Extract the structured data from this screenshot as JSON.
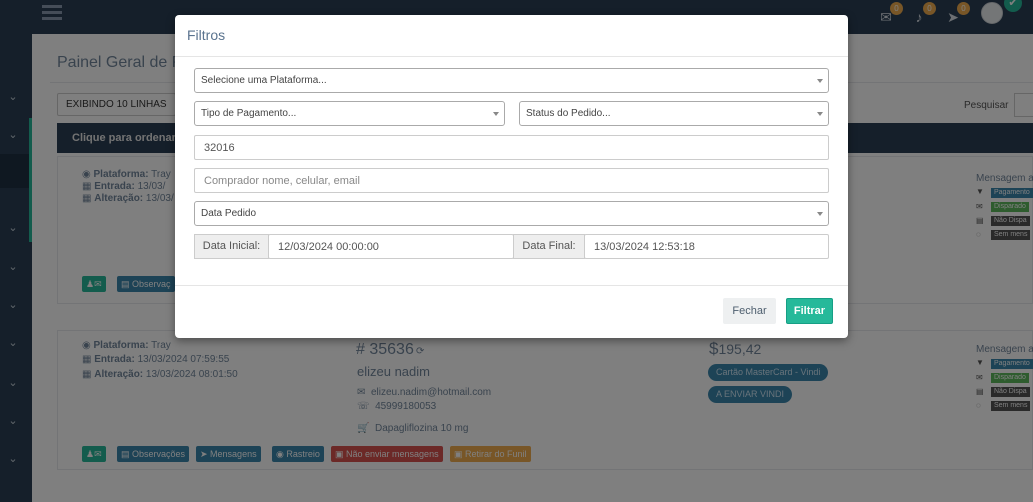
{
  "topbar": {
    "badges": [
      "0",
      "0",
      "0"
    ]
  },
  "page": {
    "title": "Painel Geral de Pe",
    "exibindo_label": "EXIBINDO 10 LINHAS",
    "search_label": "Pesquisar",
    "table_header": "Clique para ordenar ⬍"
  },
  "cards": [
    {
      "plataforma_label": "Plataforma:",
      "plataforma_value": "Tray",
      "entrada_label": "Entrada:",
      "entrada_value": "13/03/",
      "alteracao_label": "Alteração:",
      "alteracao_value": "13/03/",
      "mensagem_title": "Mensagem a",
      "tags": [
        "Pagamento",
        "Disparado",
        "Não Dispa",
        "Sem mens"
      ],
      "actions": [
        "",
        "Observaç"
      ]
    },
    {
      "plataforma_label": "Plataforma:",
      "plataforma_value": "Tray",
      "entrada_label": "Entrada:",
      "entrada_value": "13/03/2024 07:59:55",
      "alteracao_label": "Alteração:",
      "alteracao_value": "13/03/2024 08:01:50",
      "order_number": "# 35636",
      "buyer": "elizeu nadim",
      "email": "elizeu.nadim@hotmail.com",
      "phone": "45999180053",
      "product": "Dapagliflozina 10 mg",
      "currency": "$",
      "price": "195,42",
      "pill_1": "Cartão MasterCard - Vindi",
      "pill_2": "A ENVIAR VINDI",
      "mensagem_title": "Mensagem a",
      "tags": [
        "Pagamento",
        "Disparado",
        "Não Dispa",
        "Sem mens"
      ],
      "actions": [
        "",
        "Observações",
        "Mensagens",
        "Rastreio",
        "Não enviar mensagens",
        "Retirar do Funil"
      ]
    }
  ],
  "modal": {
    "title": "Filtros",
    "plataforma_select": "Selecione uma Plataforma...",
    "pagamento_select": "Tipo de Pagamento...",
    "status_select": "Status do Pedido...",
    "pedido_value": "32016",
    "comprador_placeholder": "Comprador nome, celular, email",
    "data_select": "Data Pedido",
    "data_inicial_label": "Data Inicial:",
    "data_inicial_value": "12/03/2024 00:00:00",
    "data_final_label": "Data Final:",
    "data_final_value": "13/03/2024 12:53:18",
    "fechar_label": "Fechar",
    "filtrar_label": "Filtrar"
  },
  "colors": {
    "accent": "#26b99a",
    "navy": "#2a3f54"
  }
}
